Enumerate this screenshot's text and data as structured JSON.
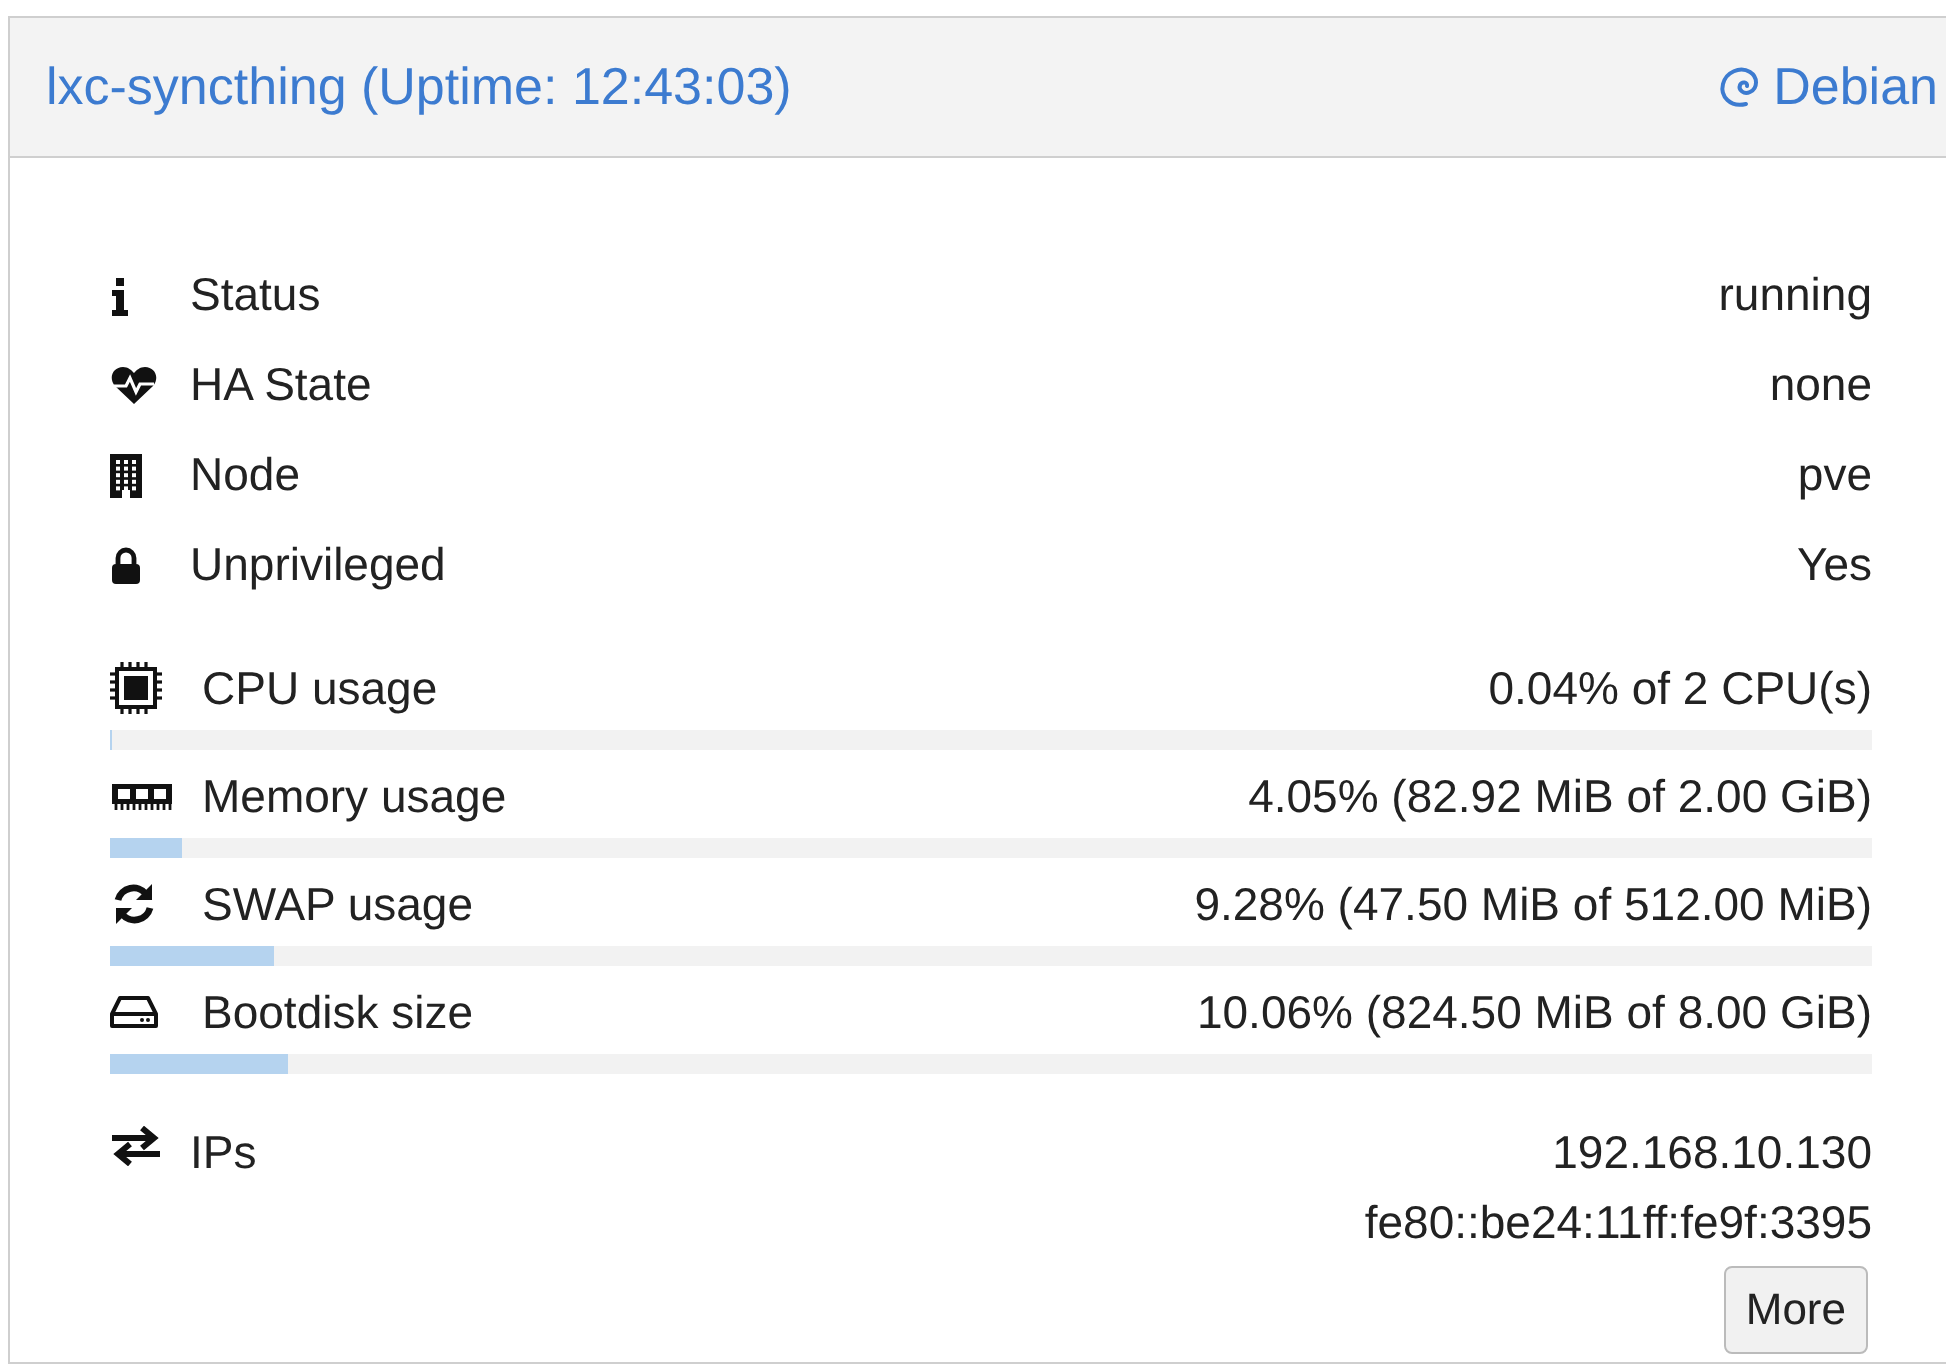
{
  "header": {
    "title": "lxc-syncthing (Uptime: 12:43:03)",
    "os": "Debian"
  },
  "info": [
    {
      "label": "Status",
      "value": "running"
    },
    {
      "label": "HA State",
      "value": "none"
    },
    {
      "label": "Node",
      "value": "pve"
    },
    {
      "label": "Unprivileged",
      "value": "Yes"
    }
  ],
  "usage": [
    {
      "label": "CPU usage",
      "value": "0.04% of 2 CPU(s)",
      "level": 0.0004
    },
    {
      "label": "Memory usage",
      "value": "4.05% (82.92 MiB of 2.00 GiB)",
      "level": 0.0405
    },
    {
      "label": "SWAP usage",
      "value": "9.28% (47.50 MiB of 512.00 MiB)",
      "level": 0.0928
    },
    {
      "label": "Bootdisk size",
      "value": "10.06% (824.50 MiB of 8.00 GiB)",
      "level": 0.1006
    }
  ],
  "ips": {
    "label": "IPs",
    "addresses": [
      "192.168.10.130",
      "fe80::be24:11ff:fe9f:3395"
    ],
    "button": "More"
  }
}
